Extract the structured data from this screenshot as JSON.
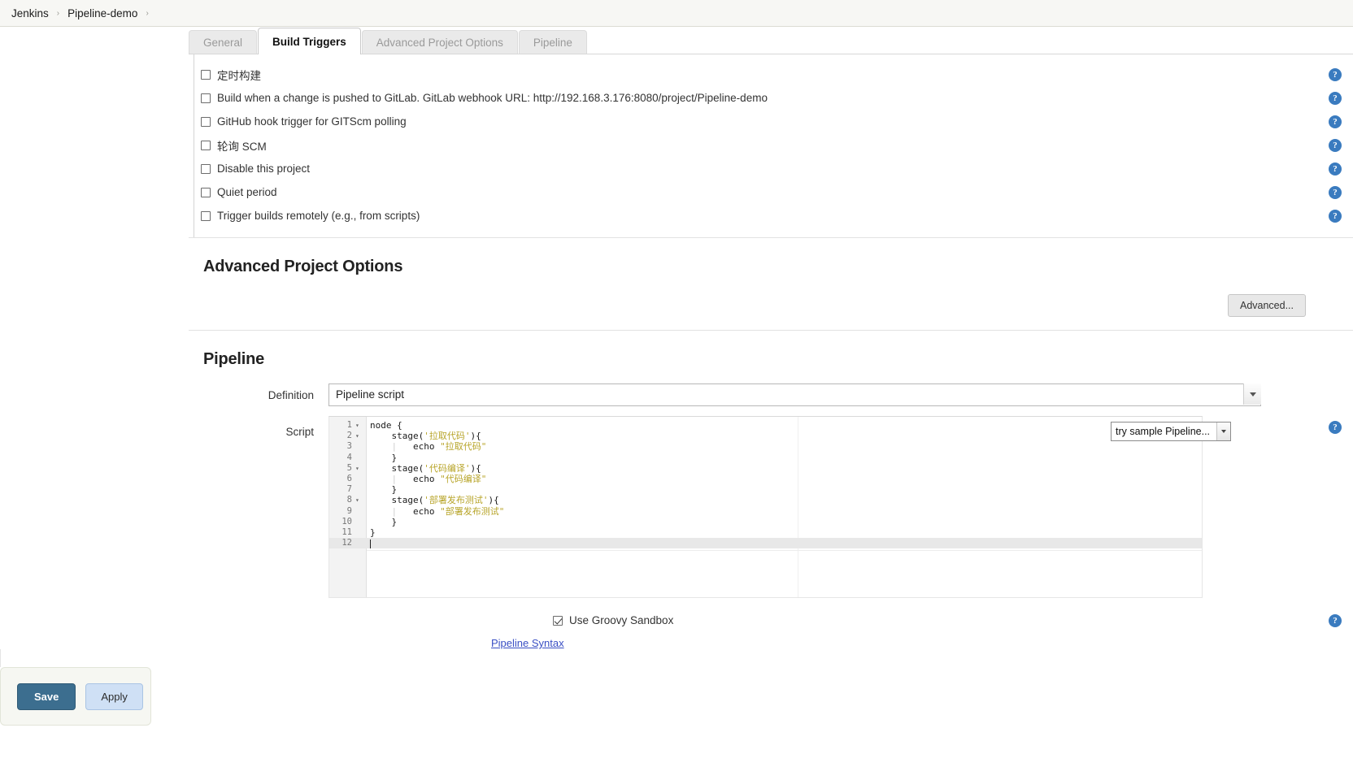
{
  "breadcrumb": {
    "items": [
      "Jenkins",
      "Pipeline-demo"
    ],
    "separator": "›",
    "trailing_separator": "›"
  },
  "tabs": [
    {
      "label": "General",
      "active": false
    },
    {
      "label": "Build Triggers",
      "active": true
    },
    {
      "label": "Advanced Project Options",
      "active": false
    },
    {
      "label": "Pipeline",
      "active": false
    }
  ],
  "build_triggers": {
    "options": [
      {
        "label": "定时构建",
        "checked": false,
        "help": "help-icon"
      },
      {
        "label": "Build when a change is pushed to GitLab. GitLab webhook URL: http://192.168.3.176:8080/project/Pipeline-demo",
        "checked": false,
        "help": "help-icon"
      },
      {
        "label": "GitHub hook trigger for GITScm polling",
        "checked": false,
        "help": "help-icon"
      },
      {
        "label": "轮询 SCM",
        "checked": false,
        "help": "help-icon"
      },
      {
        "label": "Disable this project",
        "checked": false,
        "help": "help-icon"
      },
      {
        "label": "Quiet period",
        "checked": false,
        "help": "help-icon"
      },
      {
        "label": "Trigger builds remotely (e.g., from scripts)",
        "checked": false,
        "help": "help-icon"
      }
    ]
  },
  "advanced_project_options": {
    "title": "Advanced Project Options",
    "advanced_button": "Advanced..."
  },
  "pipeline": {
    "title": "Pipeline",
    "definition_label": "Definition",
    "definition_value": "Pipeline script",
    "script_label": "Script",
    "sample_select_value": "try sample Pipeline...",
    "script_lines": [
      {
        "n": "1",
        "fold": "▾",
        "code": "node {"
      },
      {
        "n": "2",
        "fold": "▾",
        "code": "    stage('拉取代码'){"
      },
      {
        "n": "3",
        "fold": "",
        "code": "        echo \"拉取代码\""
      },
      {
        "n": "4",
        "fold": "",
        "code": "    }"
      },
      {
        "n": "5",
        "fold": "▾",
        "code": "    stage('代码编译'){"
      },
      {
        "n": "6",
        "fold": "",
        "code": "        echo \"代码编译\""
      },
      {
        "n": "7",
        "fold": "",
        "code": "    }"
      },
      {
        "n": "8",
        "fold": "▾",
        "code": "    stage('部署发布测试'){"
      },
      {
        "n": "9",
        "fold": "",
        "code": "        echo \"部署发布测试\""
      },
      {
        "n": "10",
        "fold": "",
        "code": "    }"
      },
      {
        "n": "11",
        "fold": "",
        "code": "}"
      },
      {
        "n": "12",
        "fold": "",
        "code": ""
      }
    ],
    "sandbox_label": "Use Groovy Sandbox",
    "sandbox_checked": true,
    "syntax_link": "Pipeline Syntax"
  },
  "footer": {
    "save_label": "Save",
    "apply_label": "Apply"
  },
  "colors": {
    "accent_blue": "#3a7bbf",
    "save_button": "#3c6e8f",
    "apply_button": "#cfe0f5",
    "link": "#3a4fc4",
    "string_token": "#b8a52a",
    "breadcrumb_bg": "#f7f7f4",
    "tab_inactive_bg": "#eaeaea",
    "savebar_bg": "#f6f7f2"
  }
}
